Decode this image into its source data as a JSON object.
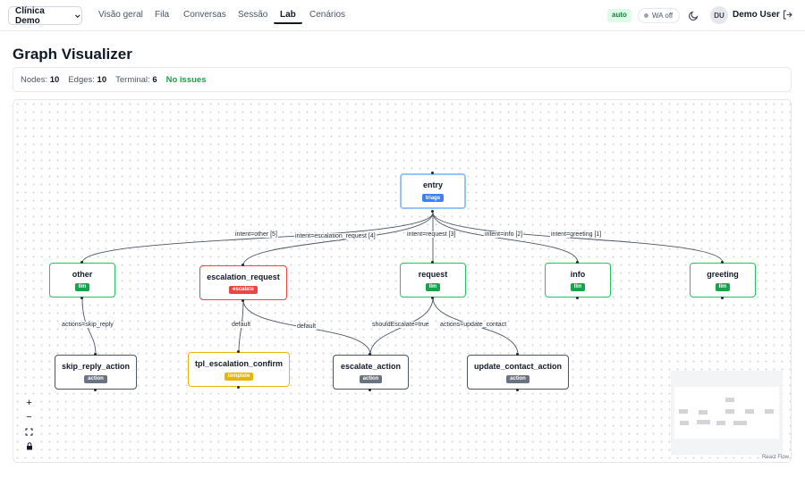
{
  "nav": {
    "clinic": "Clínica Demo",
    "items": [
      "Visão geral",
      "Fila",
      "Conversas",
      "Sessão",
      "Lab",
      "Cenários"
    ],
    "active": "Lab",
    "auto": "auto",
    "wa": "WA off",
    "avatar": "DU",
    "user": "Demo User",
    "icons": {
      "theme": "moon-icon",
      "logout": "logout-icon",
      "clinic_dropdown": "chevron-down-icon"
    }
  },
  "page": {
    "title": "Graph Visualizer"
  },
  "stats": {
    "nodes_label": "Nodes:",
    "nodes": "10",
    "edges_label": "Edges:",
    "edges": "10",
    "terminal_label": "Terminal:",
    "terminal": "6",
    "status": "No issues"
  },
  "graph": {
    "nodes": {
      "entry": {
        "label": "entry",
        "tag": "triage"
      },
      "other": {
        "label": "other",
        "tag": "llm"
      },
      "escalation_request": {
        "label": "escalation_request",
        "tag": "escalate"
      },
      "request": {
        "label": "request",
        "tag": "llm"
      },
      "info": {
        "label": "info",
        "tag": "llm"
      },
      "greeting": {
        "label": "greeting",
        "tag": "llm"
      },
      "skip_reply_action": {
        "label": "skip_reply_action",
        "tag": "action"
      },
      "tpl_escalation_confirm": {
        "label": "tpl_escalation_confirm",
        "tag": "template"
      },
      "escalate_action": {
        "label": "escalate_action",
        "tag": "action"
      },
      "update_contact_action": {
        "label": "update_contact_action",
        "tag": "action"
      }
    },
    "edge_labels": {
      "e_other": "intent=other [5]",
      "e_escalation": "intent=escalation_request [4]",
      "e_request": "intent=request [3]",
      "e_info": "intent=info [2]",
      "e_greeting": "intent=greeting [1]",
      "e_skip": "actions=skip_reply",
      "e_tpl": "default",
      "e_esc_default": "default",
      "e_should": "shouldEscalate=true",
      "e_update": "actions=update_contact"
    },
    "colors": {
      "llm": "#16a34a",
      "escalate": "#ef4444",
      "action": "#6b7280",
      "template": "#eab308",
      "triage": "#3b82f6"
    }
  },
  "controls": {
    "zoom_in": "+",
    "zoom_out": "−",
    "fit": "⛶",
    "lock": "🔒"
  },
  "attribution": "React Flow"
}
